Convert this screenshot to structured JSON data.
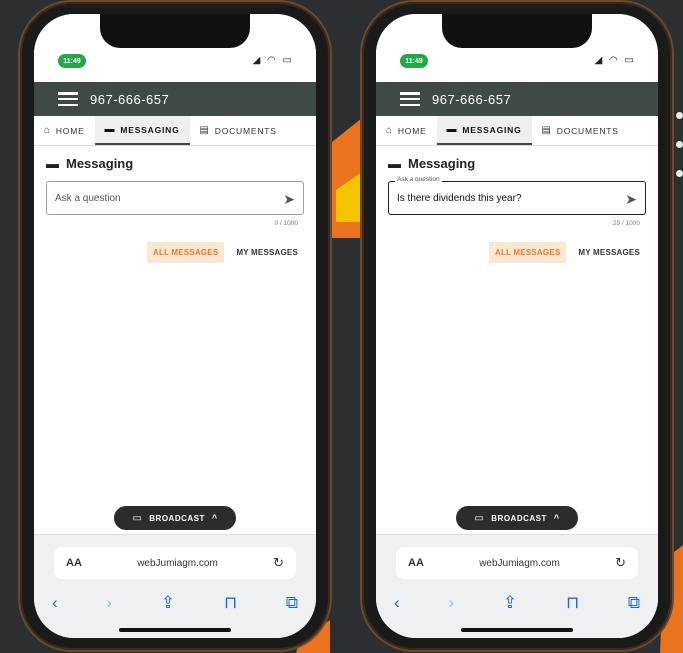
{
  "colors": {
    "background": "#2b2f31",
    "appbar": "#3f4a47",
    "accent_orange": "#e07b2a",
    "accent_orange_bg": "#fbe8d3",
    "status_green": "#22a84a",
    "ios_blue": "#1d66d9"
  },
  "phones": [
    {
      "status": {
        "time": "11:49"
      },
      "appbar": {
        "phone_number": "967-666-657"
      },
      "tabs": [
        {
          "label": "HOME",
          "icon": "home-icon"
        },
        {
          "label": "MESSAGING",
          "icon": "forum-icon",
          "active": true
        },
        {
          "label": "DOCUMENTS",
          "icon": "document-icon"
        }
      ],
      "messaging": {
        "title": "Messaging",
        "input": {
          "placeholder": "Ask a question",
          "floating_label": "",
          "value": "",
          "counter": "0 / 1000"
        },
        "filters": {
          "all": "ALL MESSAGES",
          "mine": "MY MESSAGES"
        }
      },
      "broadcast": {
        "label": "BROADCAST"
      },
      "browser": {
        "aa": "AA",
        "url": "webJumiagm.com"
      }
    },
    {
      "status": {
        "time": "11:49"
      },
      "appbar": {
        "phone_number": "967-666-657"
      },
      "tabs": [
        {
          "label": "HOME",
          "icon": "home-icon"
        },
        {
          "label": "MESSAGING",
          "icon": "forum-icon",
          "active": true
        },
        {
          "label": "DOCUMENTS",
          "icon": "document-icon"
        }
      ],
      "messaging": {
        "title": "Messaging",
        "input": {
          "placeholder": "",
          "floating_label": "Ask a question",
          "value": "Is there dividends this year?",
          "counter": "29 / 1000"
        },
        "filters": {
          "all": "ALL MESSAGES",
          "mine": "MY MESSAGES"
        }
      },
      "broadcast": {
        "label": "BROADCAST"
      },
      "browser": {
        "aa": "AA",
        "url": "webJumiagm.com"
      }
    }
  ]
}
